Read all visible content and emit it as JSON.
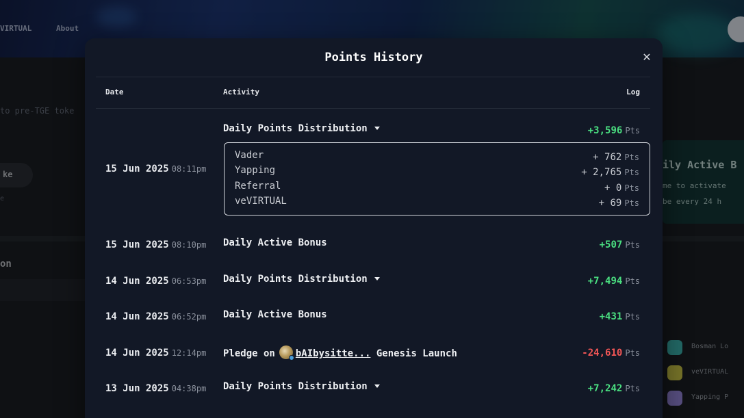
{
  "background": {
    "nav": [
      "VIRTUAL",
      "About"
    ],
    "subtitle": "to pre-TGE toke",
    "pill": "ke",
    "small": "e",
    "heading": "on",
    "card_title": "ily Active B",
    "card_line1": "me to activate",
    "card_line2": "be every 24 h",
    "list": [
      {
        "label": "Bosman Lo",
        "color": "#3fbdb8"
      },
      {
        "label": "veVIRTUAL",
        "color": "#d6d04a"
      },
      {
        "label": "Yapping P",
        "color": "#9f8ee8"
      }
    ]
  },
  "modal": {
    "title": "Points History",
    "close_icon": "close-icon",
    "columns": {
      "date": "Date",
      "activity": "Activity",
      "log": "Log"
    }
  },
  "rows": [
    {
      "date": "15 Jun 2025",
      "time": "08:11pm",
      "activity": "Daily Points Distribution",
      "value": "+3,596",
      "unit": "Pts",
      "sign": "positive",
      "expandable": true,
      "expanded": true
    },
    {
      "date": "15 Jun 2025",
      "time": "08:10pm",
      "activity": "Daily Active Bonus",
      "value": "+507",
      "unit": "Pts",
      "sign": "positive",
      "expandable": false
    },
    {
      "date": "14 Jun 2025",
      "time": "06:53pm",
      "activity": "Daily Points Distribution",
      "value": "+7,494",
      "unit": "Pts",
      "sign": "positive",
      "expandable": true
    },
    {
      "date": "14 Jun 2025",
      "time": "06:52pm",
      "activity": "Daily Active Bonus",
      "value": "+431",
      "unit": "Pts",
      "sign": "positive",
      "expandable": false
    },
    {
      "date": "14 Jun 2025",
      "time": "12:14pm",
      "activity_prefix": "Pledge on",
      "agent": "bAIbysitte...",
      "activity_suffix": "Genesis Launch",
      "value": "-24,610",
      "unit": "Pts",
      "sign": "negative"
    },
    {
      "date": "13 Jun 2025",
      "time": "04:38pm",
      "activity": "Daily Points Distribution",
      "value": "+7,242",
      "unit": "Pts",
      "sign": "positive",
      "expandable": true
    }
  ],
  "breakdown": [
    {
      "name": "Vader",
      "value": "+ 762",
      "unit": "Pts"
    },
    {
      "name": "Yapping",
      "value": "+ 2,765",
      "unit": "Pts"
    },
    {
      "name": "Referral",
      "value": "+ 0",
      "unit": "Pts"
    },
    {
      "name": "veVIRTUAL",
      "value": "+ 69",
      "unit": "Pts"
    }
  ],
  "colors": {
    "positive": "#4ade80",
    "negative": "#f25656",
    "modal_bg": "#121826"
  }
}
